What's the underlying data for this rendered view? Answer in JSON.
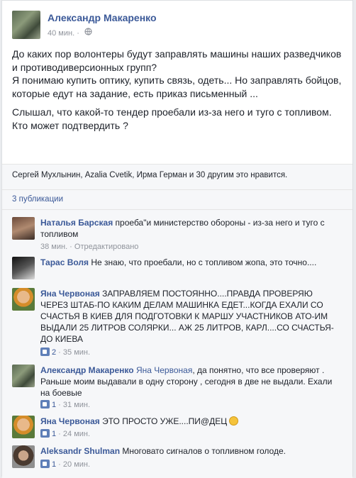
{
  "post": {
    "author": "Александр Макаренко",
    "time": "40 мин.",
    "globe": "·",
    "paragraphs": [
      "До каких пор волонтеры будут заправлять машины наших разведчиков и противодиверсионных групп?\nЯ понимаю купить оптику, купить связь, одеть... Но заправлять бойцов, которые едут на задание, есть приказ письменный ...",
      "Слышал, что какой-то тендер проебали из-за него и туго с топливом. Кто может подтвердить ?"
    ],
    "likes_text": "Сергей Мухлынин, Azalia Cvetik, Ирма Герман и 30 другим это нравится.",
    "shares_text": "3 публикации"
  },
  "comments": [
    {
      "author": "Наталья Барская",
      "text": " проеба\"и министерство обороны - из-за него и туго с топливом",
      "meta": "38 мин. · Отредактировано"
    },
    {
      "author": "Тарас Воля",
      "text": " Не знаю, что проебали, но с топливом жопа, это точно...."
    },
    {
      "author": "Яна Червоная",
      "text": " ЗАПРАВЛЯЕМ ПОСТОЯННО....ПРАВДА ПРОВЕРЯЮ ЧЕРЕЗ ШТАБ-ПО КАКИМ ДЕЛАМ МАШИНКА ЕДЕТ...КОГДА ЕХАЛИ СО СЧАСТЬЯ В КИЕВ ДЛЯ ПОДГОТОВКИ К МАРШУ УЧАСТНИКОВ АТО-ИМ ВЫДАЛИ 25 ЛИТРОВ СОЛЯРКИ... АЖ 25 ЛИТРОВ, КАРЛ....СО СЧАСТЬЯ-ДО КИЕВА",
      "likes": "2",
      "meta": " · 35 мин."
    },
    {
      "author": "Александр Макаренко",
      "mention": "Яна Червоная",
      "text": ", да понятно, что все проверяют . Раньше моим выдавали в одну сторону , сегодня в две не выдали. Ехали на боевые",
      "likes": "1",
      "meta": " · 31 мин."
    },
    {
      "author": "Яна Червоная",
      "text": " ЭТО ПРОСТО УЖЕ....ПИ@ДЕЦ",
      "likes": "1",
      "meta": " · 24 мин."
    },
    {
      "author": "Aleksandr Shulman",
      "text": " Многовато сигналов о топливном голоде.",
      "likes": "1",
      "meta": " · 20 мин."
    }
  ]
}
